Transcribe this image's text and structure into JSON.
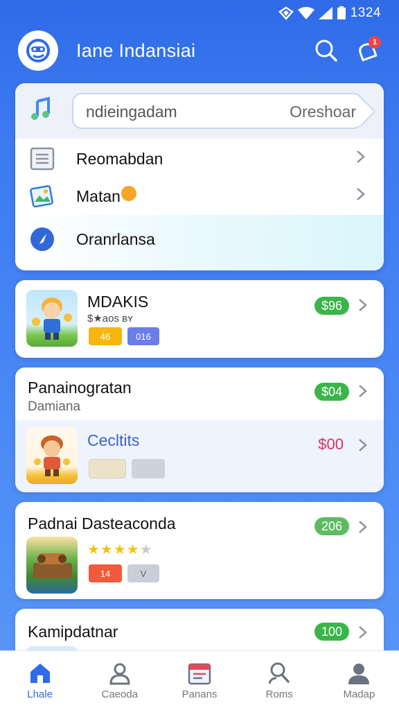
{
  "status_bar": {
    "time": "1324"
  },
  "header": {
    "title": "Iane Indansiai",
    "notif_count": "1"
  },
  "search": {
    "value": "ndieingadam",
    "right_text": "Oreshoar"
  },
  "menu": [
    {
      "label": "Reomabdan",
      "icon": "list-icon"
    },
    {
      "label": "Matan",
      "icon": "photo-icon"
    },
    {
      "label": "Oranrlansa",
      "icon": "compass-icon"
    }
  ],
  "games": [
    {
      "title": "MDAKIS",
      "meta": "$★aos ʙʏ",
      "price": "$96",
      "tags": [
        "46",
        "016"
      ]
    },
    {
      "title": "Panainogratan",
      "subtitle": "Damiana",
      "price": "$04",
      "sub": {
        "title": "Cecltits",
        "price": "$00"
      }
    },
    {
      "title": "Padnai  Dasteaconda",
      "price": "206",
      "rating": 4,
      "tags": [
        "14",
        "V"
      ]
    },
    {
      "title": "Kamipdatnar",
      "price": "100"
    }
  ],
  "nav": [
    {
      "label": "Lhale",
      "icon": "home-icon",
      "active": true
    },
    {
      "label": "Caeoda",
      "icon": "user-outline-icon"
    },
    {
      "label": "Panans",
      "icon": "calendar-icon"
    },
    {
      "label": "Roms",
      "icon": "search-person-icon"
    },
    {
      "label": "Madap",
      "icon": "profile-icon"
    }
  ],
  "colors": {
    "primary": "#2f6be8",
    "price_green": "#3ab54a",
    "price_red": "#d9305c",
    "tag_yellow": "#f5b70e",
    "tag_blue": "#6a7de8",
    "tag_red": "#f15a3b"
  }
}
